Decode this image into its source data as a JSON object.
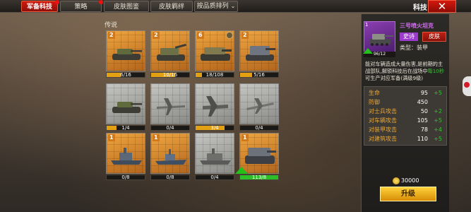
{
  "tabs": [
    {
      "label": "军备科技",
      "active": true,
      "badge": true
    },
    {
      "label": "策略",
      "active": false,
      "badge": true
    },
    {
      "label": "皮肤图鉴",
      "active": false,
      "badge": false
    },
    {
      "label": "皮肤羁绊",
      "active": false,
      "badge": false
    }
  ],
  "sort_label": "按品质排列",
  "window_title": "科技",
  "close_label": "✕",
  "section_label": "传说",
  "cards": [
    {
      "level": "2",
      "progress": "6/16",
      "fill": 0.375,
      "style": "orange",
      "icon": "tank-icon"
    },
    {
      "level": "2",
      "progress": "10/16",
      "fill": 0.625,
      "style": "orange",
      "icon": "artillery-tank-icon"
    },
    {
      "level": "6",
      "progress": "18/108",
      "fill": 0.17,
      "style": "orange",
      "icon": "heavy-tank-icon",
      "medal": true
    },
    {
      "level": "2",
      "progress": "5/16",
      "fill": 0.31,
      "style": "orange",
      "icon": "mobile-cannon-icon"
    },
    {
      "level": "",
      "progress": "1/4",
      "fill": 0.25,
      "style": "gray",
      "icon": "tank-icon"
    },
    {
      "level": "",
      "progress": "0/4",
      "fill": 0.0,
      "style": "gray",
      "icon": "fighter-plane-icon"
    },
    {
      "level": "",
      "progress": "3/4",
      "fill": 0.75,
      "style": "gray",
      "icon": "bomber-plane-icon"
    },
    {
      "level": "",
      "progress": "0/4",
      "fill": 0.0,
      "style": "gray",
      "icon": "jet-plane-icon"
    },
    {
      "level": "1",
      "progress": "0/8",
      "fill": 0.0,
      "style": "orange",
      "icon": "battleship-icon"
    },
    {
      "level": "1",
      "progress": "0/8",
      "fill": 0.0,
      "style": "orange",
      "icon": "destroyer-icon"
    },
    {
      "level": "",
      "progress": "0/4",
      "fill": 0.0,
      "style": "gray",
      "icon": "cruiser-icon"
    },
    {
      "level": "1",
      "progress": "113/8",
      "fill": 1.0,
      "style": "orange",
      "icon": "super-heavy-tank-icon",
      "upgradable": true
    }
  ],
  "detail": {
    "portrait_level": "1",
    "portrait_progress": "96/12",
    "name": "三号喷火坦克",
    "rarity": "史诗",
    "skin_button": "皮肤",
    "type_line": "类型：装甲",
    "desc_before": "能对车辆造成大量伤害,是前期的主战部队,解锁科技后在战场中",
    "desc_highlight": "每10秒",
    "desc_after": "可生产对应军备(满级9级)",
    "stats": [
      {
        "label": "生命",
        "value": "95",
        "bonus": "+5"
      },
      {
        "label": "防御",
        "value": "450",
        "bonus": ""
      },
      {
        "label": "对士兵攻击",
        "value": "50",
        "bonus": "+2"
      },
      {
        "label": "对车辆攻击",
        "value": "105",
        "bonus": "+5"
      },
      {
        "label": "对装甲攻击",
        "value": "78",
        "bonus": "+4"
      },
      {
        "label": "对建筑攻击",
        "value": "110",
        "bonus": "+5"
      }
    ],
    "cost": "30000",
    "upgrade_label": "升级"
  },
  "colors": {
    "tab_active": "#c4150c",
    "card_orange": "#e0923a",
    "card_gray": "#b5b5b2",
    "progress_fill": "#e4a013",
    "progress_full": "#2cbf28",
    "stat_label": "#e6a637",
    "bonus": "#2ec52a",
    "rarity_epic": "#9d3bd0"
  }
}
